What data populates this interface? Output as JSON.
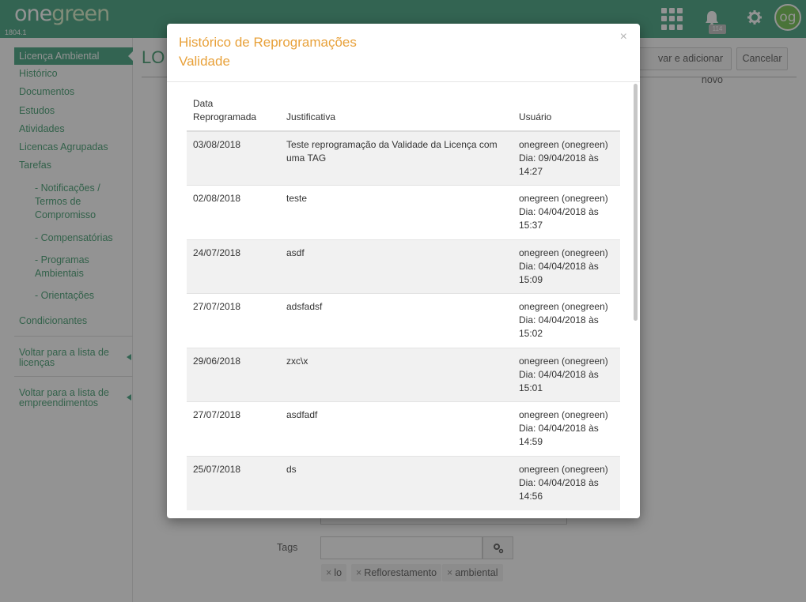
{
  "header": {
    "logo_text_one": "one",
    "logo_text_green": "green",
    "version": "1804.1",
    "notification_count": "114",
    "avatar_initials": "og"
  },
  "sidebar": {
    "items": [
      {
        "label": "Licença Ambiental",
        "active": true
      },
      {
        "label": "Histórico"
      },
      {
        "label": "Documentos"
      },
      {
        "label": "Estudos"
      },
      {
        "label": "Atividades"
      },
      {
        "label": "Licencas Agrupadas"
      },
      {
        "label": "Tarefas"
      }
    ],
    "subitems": [
      {
        "label": "- Notificações / Termos de Compromisso"
      },
      {
        "label": "- Compensatórias"
      },
      {
        "label": "- Programas Ambientais"
      },
      {
        "label": "- Orientações"
      }
    ],
    "condicionantes": "Condicionantes",
    "back_licencas": "Voltar para a lista de licenças",
    "back_empreendimentos": "Voltar para a lista de empreendimentos"
  },
  "main": {
    "title_partial": "LO",
    "save_add_label": "var e adicionar novo",
    "cancel_label": "Cancelar",
    "tags_label": "Tags",
    "tags": [
      "lo",
      "Reflorestamento",
      "ambiental"
    ]
  },
  "modal": {
    "title_line1": "Histórico de Reprogramações",
    "title_line2": "Validade",
    "close_symbol": "×",
    "columns": {
      "date_line1": "Data",
      "date_line2": "Reprogramada",
      "justification": "Justificativa",
      "user": "Usuário"
    },
    "rows": [
      {
        "date": "03/08/2018",
        "justification": "Teste reprogramação da Validade da Licença com uma TAG",
        "user": "onegreen (onegreen)",
        "when_date": "Dia: 09/04/2018 às",
        "when_time": "14:27"
      },
      {
        "date": "02/08/2018",
        "justification": "teste",
        "user": "onegreen (onegreen)",
        "when_date": "Dia: 04/04/2018 às",
        "when_time": "15:37"
      },
      {
        "date": "24/07/2018",
        "justification": "asdf",
        "user": "onegreen (onegreen)",
        "when_date": "Dia: 04/04/2018 às",
        "when_time": "15:09"
      },
      {
        "date": "27/07/2018",
        "justification": "adsfadsf",
        "user": "onegreen (onegreen)",
        "when_date": "Dia: 04/04/2018 às",
        "when_time": "15:02"
      },
      {
        "date": "29/06/2018",
        "justification": "zxc\\x",
        "user": "onegreen (onegreen)",
        "when_date": "Dia: 04/04/2018 às",
        "when_time": "15:01"
      },
      {
        "date": "27/07/2018",
        "justification": "asdfadf",
        "user": "onegreen (onegreen)",
        "when_date": "Dia: 04/04/2018 às",
        "when_time": "14:59"
      },
      {
        "date": "25/07/2018",
        "justification": "ds",
        "user": "onegreen (onegreen)",
        "when_date": "Dia: 04/04/2018 às",
        "when_time": "14:56"
      }
    ]
  },
  "colors": {
    "brand_green": "#3ea07d",
    "link_green": "#3d9a6c",
    "modal_title": "#e8a13a"
  }
}
